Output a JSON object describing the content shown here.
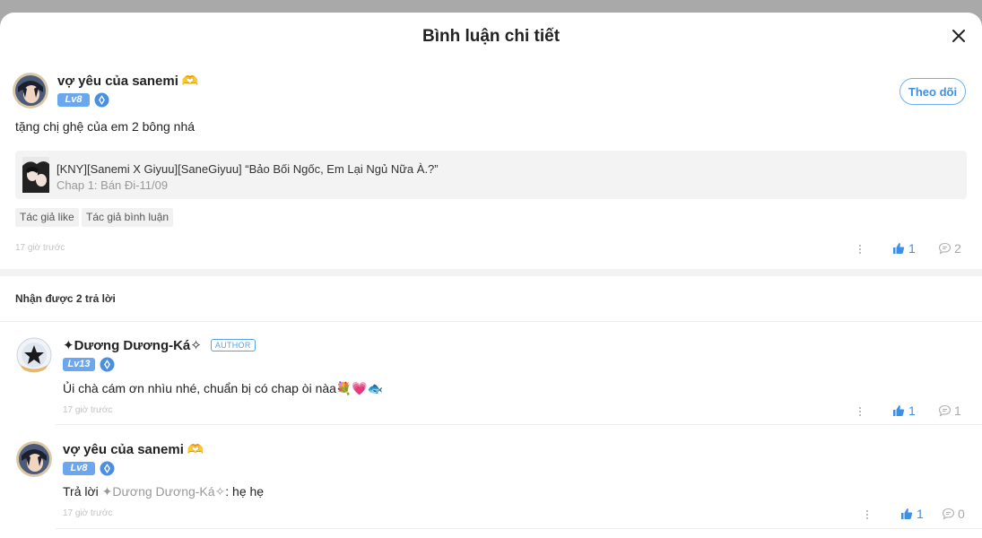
{
  "header": {
    "title": "Bình luận chi tiết"
  },
  "main_comment": {
    "username": "vợ yêu của sanemi",
    "name_emoji": "🫶",
    "level": "Lv8",
    "follow_label": "Theo dõi",
    "text": "tặng chị ghệ của em 2 bông nhá",
    "story": {
      "title": "[KNY][Sanemi X Giyuu][SaneGiyuu] “Bảo Bối Ngốc, Em Lại Ngủ Nữa À.?”",
      "chapter": "Chap 1: Bán Đi-11/09"
    },
    "tags": [
      "Tác giả like",
      "Tác giả bình luận"
    ],
    "time": "17 giờ trước",
    "likes": "1",
    "replies": "2"
  },
  "replies_section": {
    "label": "Nhận được 2 trả lời"
  },
  "replies": [
    {
      "username": "✦Dương Dương-Ká✧",
      "author_label": "AUTHOR",
      "level": "Lv13",
      "text": "Ủi chà cám ơn nhìu nhé, chuẩn bị có chap òi nàa💐💗🐟",
      "time": "17 giờ trước",
      "likes": "1",
      "replies": "1"
    },
    {
      "username": "vợ yêu của sanemi",
      "name_emoji": "🫶",
      "level": "Lv8",
      "reply_prefix": "Trả lời ",
      "reply_to": "✦Dương Dương-Ká✧",
      "text": ": hẹ hẹ",
      "time": "17 giờ trước",
      "likes": "1",
      "replies": "0"
    }
  ],
  "icons": {
    "close": "close-icon",
    "like": "thumbs-up-icon",
    "comment": "speech-bubble-icon",
    "more": "more-vertical-icon",
    "gem": "level-gem-icon"
  },
  "colors": {
    "accent": "#3d8fe5",
    "level_badge": "#6aa7ee",
    "backdrop": "#a9a9a9"
  }
}
